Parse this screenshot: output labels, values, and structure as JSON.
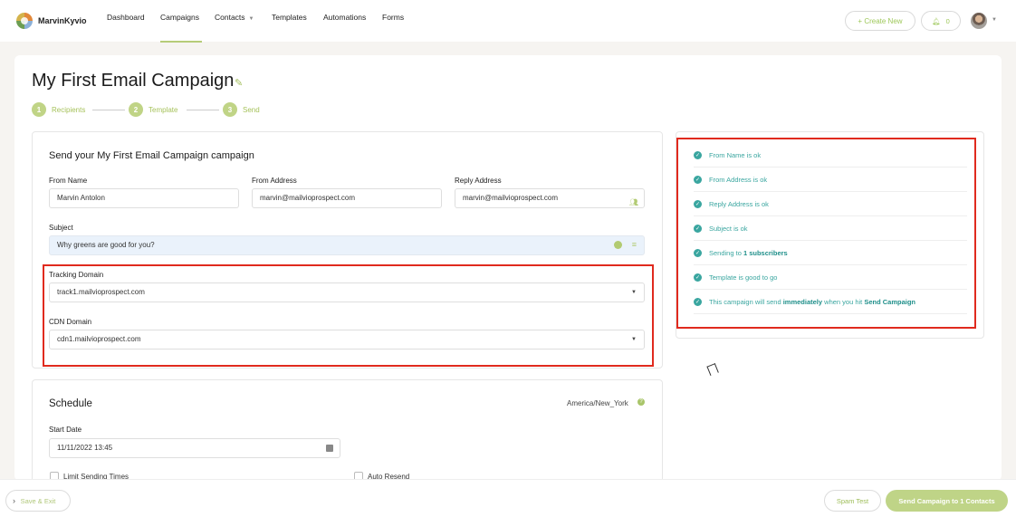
{
  "brand": {
    "name": "MarvinKyvio"
  },
  "nav": {
    "items": [
      {
        "label": "Dashboard"
      },
      {
        "label": "Campaigns"
      },
      {
        "label": "Contacts"
      },
      {
        "label": "Templates"
      },
      {
        "label": "Automations"
      },
      {
        "label": "Forms"
      }
    ],
    "active": "Campaigns",
    "create_new": "+ Create New",
    "notifications_count": "0"
  },
  "page": {
    "title": "My First Email Campaign"
  },
  "steps": [
    {
      "num": "1",
      "label": "Recipients"
    },
    {
      "num": "2",
      "label": "Template"
    },
    {
      "num": "3",
      "label": "Send"
    }
  ],
  "send_form": {
    "heading": "Send your My First Email Campaign campaign",
    "from_name_label": "From Name",
    "from_name_value": "Marvin Antolon",
    "from_address_label": "From Address",
    "from_address_value": "marvin@mailvioprospect.com",
    "reply_address_label": "Reply Address",
    "reply_address_value": "marvin@mailvioprospect.com",
    "subject_label": "Subject",
    "subject_value": "Why greens are good for you?",
    "tracking_domain_label": "Tracking Domain",
    "tracking_domain_value": "track1.mailvioprospect.com",
    "cdn_domain_label": "CDN Domain",
    "cdn_domain_value": "cdn1.mailvioprospect.com"
  },
  "schedule": {
    "heading": "Schedule",
    "timezone": "America/New_York",
    "start_date_label": "Start Date",
    "start_date_value": "11/11/2022 13:45",
    "limit_sending_label": "Limit Sending Times",
    "auto_resend_label": "Auto Resend"
  },
  "checklist": {
    "from_name": "From Name is ok",
    "from_address": "From Address is ok",
    "reply_address": "Reply Address is ok",
    "subject": "Subject is ok",
    "sending_prefix": "Sending to ",
    "sending_bold": "1 subscribers",
    "template": "Template is good to go",
    "send_prefix": "This campaign will send ",
    "send_bold1": "immediately",
    "send_mid": " when you hit ",
    "send_bold2": "Send Campaign"
  },
  "footer": {
    "save_exit": "Save & Exit",
    "spam_test": "Spam Test",
    "send_campaign": "Send Campaign to 1 Contacts"
  },
  "colors": {
    "accent_green": "#bfd487",
    "check_teal": "#3aa6a0",
    "highlight_red": "#e02a1e"
  }
}
